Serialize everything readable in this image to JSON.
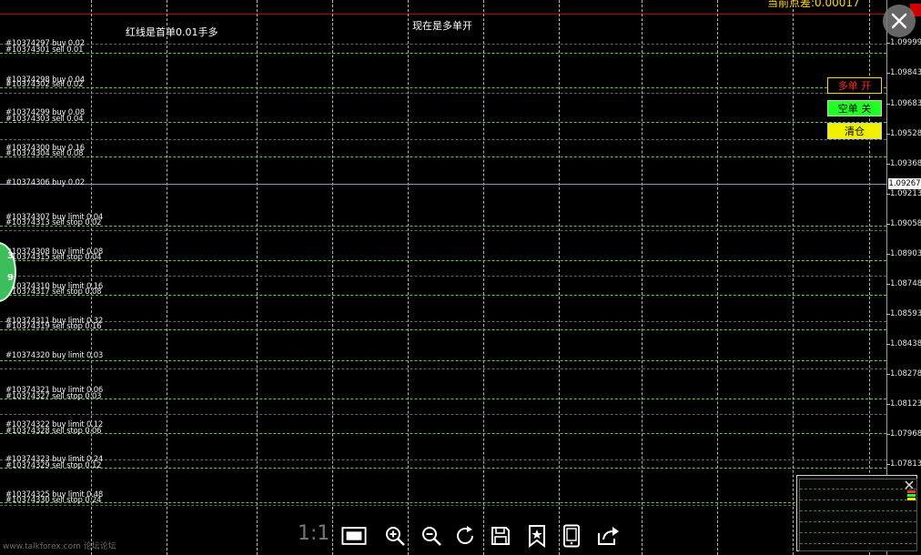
{
  "top_right_indicator": "当前点差:0.00017",
  "red_line_note": "红线是首单0.01手多",
  "status_text": "现在是多单开",
  "buttons": {
    "long": "多单 开",
    "short": "空单 关",
    "close_all": "清仓"
  },
  "current_price": "1.09267",
  "price_axis": [
    "1.09999",
    "1.09843",
    "1.09683",
    "1.09528",
    "1.09368",
    "1.09213",
    "1.09058",
    "1.08903",
    "1.08748",
    "1.08593",
    "1.08438",
    "1.08278",
    "1.08123",
    "1.07968",
    "1.07813"
  ],
  "orders": [
    {
      "a": "#10374297 buy 0.02",
      "b": "#10374301 sell 0.01"
    },
    {
      "a": "#10374298 buy 0.04",
      "b": "#10374302 sell 0.02"
    },
    {
      "a": "#10374299 buy 0.08",
      "b": "#10374303 sell 0.04"
    },
    {
      "a": "#10374300 buy 0.16",
      "b": "#10374304 sell 0.08"
    },
    {
      "a": "#10374306 buy 0.02",
      "b": ""
    },
    {
      "a": "#10374307 buy limit 0.04",
      "b": "#10374313 sell stop 0.02"
    },
    {
      "a": "#10374308 buy limit 0.08",
      "b": "#10374315 sell stop 0.04"
    },
    {
      "a": "#10374310 buy limit 0.16",
      "b": "#10374317 sell stop 0.08"
    },
    {
      "a": "#10374311 buy limit 0.32",
      "b": "#10374319 sell stop 0.16"
    },
    {
      "a": "#10374320 buy limit 0.03",
      "b": ""
    },
    {
      "a": "#10374321 buy limit 0.06",
      "b": "#10374327 sell stop 0.03"
    },
    {
      "a": "#10374322 buy limit 0.12",
      "b": "#10374328 sell stop 0.06"
    },
    {
      "a": "#10374323 buy limit 0.24",
      "b": "#10374329 sell stop 0.12"
    },
    {
      "a": "#10374325 buy limit 0.48",
      "b": "#10374330 sell stop 0.24"
    }
  ],
  "toolbar": {
    "ratio_label": "1:1",
    "icons": [
      "fit-screen-icon",
      "zoom-in-icon",
      "zoom-out-icon",
      "rotate-icon",
      "save-icon",
      "bookmark-icon",
      "tablet-icon",
      "share-icon"
    ]
  },
  "watermark": "www.talkforex.com 论坛论坛"
}
